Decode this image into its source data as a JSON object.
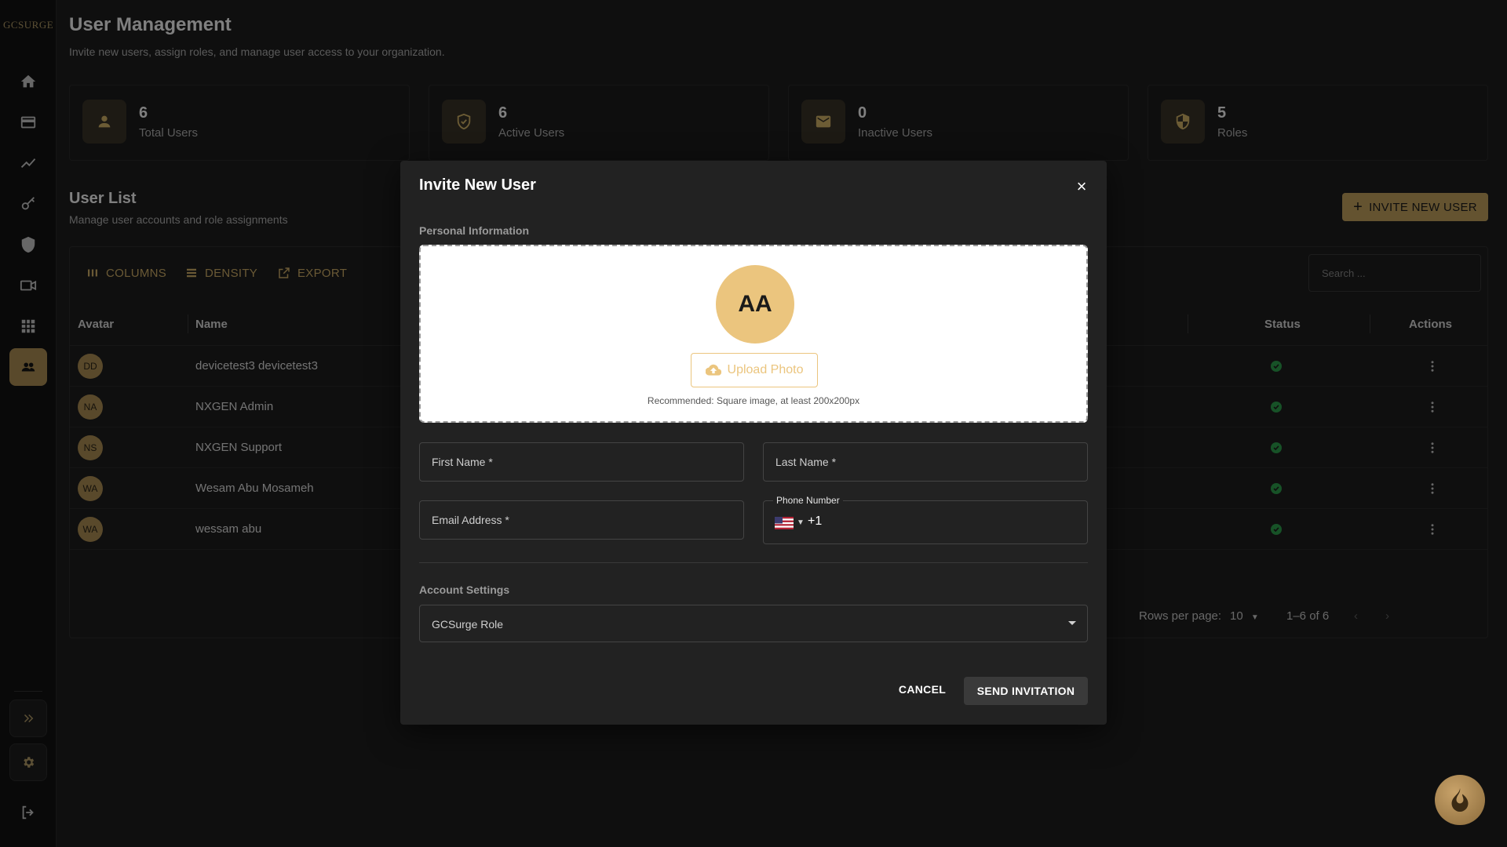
{
  "logo_text": "GCSURGE",
  "sidebar": {
    "items": [
      {
        "name": "home-icon"
      },
      {
        "name": "card-icon"
      },
      {
        "name": "analytics-icon"
      },
      {
        "name": "key-icon"
      },
      {
        "name": "shield-icon"
      },
      {
        "name": "video-icon"
      },
      {
        "name": "grid-icon"
      },
      {
        "name": "users-icon",
        "active": true
      }
    ],
    "bottom": [
      {
        "name": "expand-icon"
      },
      {
        "name": "gear-icon"
      },
      {
        "name": "logout-icon"
      }
    ]
  },
  "page": {
    "title": "User Management",
    "subtitle": "Invite new users, assign roles, and manage user access to your organization."
  },
  "stats": [
    {
      "value": "6",
      "label": "Total Users",
      "icon": "person-icon"
    },
    {
      "value": "6",
      "label": "Active Users",
      "icon": "shield-check-icon"
    },
    {
      "value": "0",
      "label": "Inactive Users",
      "icon": "mail-icon"
    },
    {
      "value": "5",
      "label": "Roles",
      "icon": "security-icon"
    }
  ],
  "user_list": {
    "title": "User List",
    "subtitle": "Manage user accounts and role assignments",
    "invite_button": "INVITE NEW USER",
    "toolbar": {
      "columns": "COLUMNS",
      "density": "DENSITY",
      "export": "EXPORT"
    },
    "search_placeholder": "Search ...",
    "headers": {
      "avatar": "Avatar",
      "name": "Name",
      "status": "Status",
      "actions": "Actions"
    },
    "rows": [
      {
        "initials": "DD",
        "name": "devicetest3 devicetest3"
      },
      {
        "initials": "NA",
        "name": "NXGEN Admin"
      },
      {
        "initials": "NS",
        "name": "NXGEN Support"
      },
      {
        "initials": "WA",
        "name": "Wesam Abu Mosameh"
      },
      {
        "initials": "WA",
        "name": "wessam abu"
      }
    ],
    "pagination": {
      "rows_per_page_label": "Rows per page:",
      "rows_per_page": "10",
      "range": "1–6 of 6"
    }
  },
  "modal": {
    "title": "Invite New User",
    "close": "×",
    "personal_label": "Personal Information",
    "avatar_initials": "AA",
    "upload_button": "Upload Photo",
    "upload_hint": "Recommended: Square image, at least 200x200px",
    "first_name": "First Name *",
    "last_name": "Last Name *",
    "email": "Email Address *",
    "phone_label": "Phone Number",
    "phone_code": "+1",
    "account_label": "Account Settings",
    "role_select": "GCSurge Role",
    "cancel": "CANCEL",
    "send": "SEND INVITATION"
  },
  "colors": {
    "accent": "#c9a760",
    "status_green": "#2ea44f"
  }
}
